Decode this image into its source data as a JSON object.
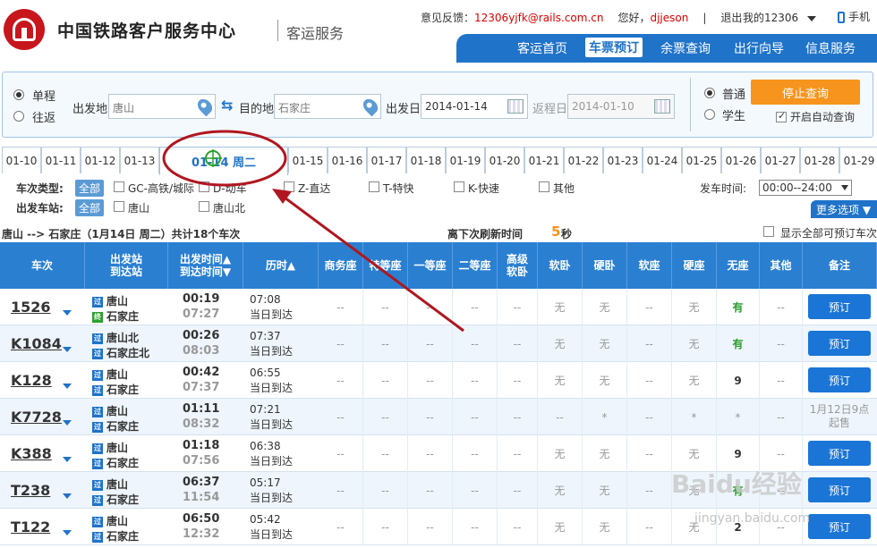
{
  "header": {
    "site_title": "中国铁路客户服务中心",
    "site_sub": "客运服务",
    "feedback_label": "意见反馈：",
    "feedback_email": "12306yjfk@rails.com.cn",
    "greeting": "您好，",
    "username": "djjeson",
    "logout": "退出",
    "my_account": "我的12306",
    "mobile": "手机"
  },
  "nav": [
    "客运首页",
    "车票预订",
    "余票查询",
    "出行向导",
    "信息服务"
  ],
  "search": {
    "trip_single": "单程",
    "trip_round": "往返",
    "from_label": "出发地",
    "from_value": "唐山",
    "to_label": "目的地",
    "to_value": "石家庄",
    "date_label": "出发日",
    "date_value": "2014-01-14",
    "return_label": "返程日",
    "return_value": "2014-01-10",
    "ticket_normal": "普通",
    "ticket_student": "学生",
    "stop_button": "停止查询",
    "auto_query": "开启自动查询"
  },
  "date_tabs": [
    "01-10",
    "01-11",
    "01-12",
    "01-13",
    "01-14 周二",
    "01-15",
    "01-16",
    "01-17",
    "01-18",
    "01-19",
    "01-20",
    "01-21",
    "01-22",
    "01-23",
    "01-24",
    "01-25",
    "01-26",
    "01-27",
    "01-28",
    "01-29"
  ],
  "filters": {
    "type_label": "车次类型:",
    "all": "全部",
    "types": [
      "GC-高铁/城际",
      "D-动车",
      "Z-直达",
      "T-特快",
      "K-快速",
      "其他"
    ],
    "station_label": "出发车站:",
    "stations": [
      "唐山",
      "唐山北"
    ],
    "time_label": "发车时间:",
    "time_value": "00:00--24:00",
    "more": "更多选项"
  },
  "summary": {
    "route": "唐山 --> 石家庄（1月14日 周二）共计18个车次",
    "refresh_label": "离下次刷新时间",
    "refresh_value": "5",
    "refresh_unit": "秒",
    "show_all": "显示全部可预订车次"
  },
  "columns": [
    {
      "l1": "车次",
      "l2": ""
    },
    {
      "l1": "出发站",
      "l2": "到达站"
    },
    {
      "l1": "出发时间▲",
      "l2": "到达时间▼"
    },
    {
      "l1": "历时▲",
      "l2": ""
    },
    {
      "l1": "商务座",
      "l2": ""
    },
    {
      "l1": "特等座",
      "l2": ""
    },
    {
      "l1": "一等座",
      "l2": ""
    },
    {
      "l1": "二等座",
      "l2": ""
    },
    {
      "l1": "高级",
      "l2": "软卧"
    },
    {
      "l1": "软卧",
      "l2": ""
    },
    {
      "l1": "硬卧",
      "l2": ""
    },
    {
      "l1": "软座",
      "l2": ""
    },
    {
      "l1": "硬座",
      "l2": ""
    },
    {
      "l1": "无座",
      "l2": ""
    },
    {
      "l1": "其他",
      "l2": ""
    },
    {
      "l1": "备注",
      "l2": ""
    }
  ],
  "trains": [
    {
      "no": "1526",
      "from_tag": "过",
      "from": "唐山",
      "to_tag": "终",
      "to": "石家庄",
      "dep": "00:19",
      "arr": "07:27",
      "dur": "07:08",
      "arrive_day": "当日到达",
      "seats": [
        "--",
        "--",
        "--",
        "--",
        "--",
        "无",
        "无",
        "--",
        "无",
        "有",
        "--"
      ],
      "action": "预订"
    },
    {
      "no": "K1084",
      "from_tag": "过",
      "from": "唐山北",
      "to_tag": "过",
      "to": "石家庄北",
      "dep": "00:26",
      "arr": "08:03",
      "dur": "07:37",
      "arrive_day": "当日到达",
      "seats": [
        "--",
        "--",
        "--",
        "--",
        "--",
        "无",
        "无",
        "--",
        "无",
        "有",
        "--"
      ],
      "action": "预订"
    },
    {
      "no": "K128",
      "from_tag": "过",
      "from": "唐山",
      "to_tag": "过",
      "to": "石家庄",
      "dep": "00:42",
      "arr": "07:37",
      "dur": "06:55",
      "arrive_day": "当日到达",
      "seats": [
        "--",
        "--",
        "--",
        "--",
        "--",
        "无",
        "无",
        "--",
        "无",
        "9",
        "--"
      ],
      "action": "预订"
    },
    {
      "no": "K7728",
      "from_tag": "过",
      "from": "唐山",
      "to_tag": "过",
      "to": "石家庄",
      "dep": "01:11",
      "arr": "08:32",
      "dur": "07:21",
      "arrive_day": "当日到达",
      "seats": [
        "--",
        "--",
        "--",
        "--",
        "--",
        "--",
        "*",
        "--",
        "*",
        "*",
        "--"
      ],
      "note": "1月12日9点起售"
    },
    {
      "no": "K388",
      "from_tag": "过",
      "from": "唐山",
      "to_tag": "过",
      "to": "石家庄",
      "dep": "01:18",
      "arr": "07:56",
      "dur": "06:38",
      "arrive_day": "当日到达",
      "seats": [
        "--",
        "--",
        "--",
        "--",
        "--",
        "无",
        "无",
        "--",
        "无",
        "9",
        "--"
      ],
      "action": "预订"
    },
    {
      "no": "T238",
      "from_tag": "过",
      "from": "唐山",
      "to_tag": "过",
      "to": "石家庄",
      "dep": "06:37",
      "arr": "11:54",
      "dur": "05:17",
      "arrive_day": "当日到达",
      "seats": [
        "--",
        "--",
        "--",
        "--",
        "--",
        "无",
        "无",
        "--",
        "无",
        "有",
        "--"
      ],
      "action": "预订"
    },
    {
      "no": "T122",
      "from_tag": "过",
      "from": "唐山",
      "to_tag": "过",
      "to": "石家庄",
      "dep": "06:50",
      "arr": "12:32",
      "dur": "05:42",
      "arrive_day": "当日到达",
      "seats": [
        "--",
        "--",
        "--",
        "--",
        "--",
        "无",
        "无",
        "--",
        "无",
        "2",
        "--"
      ],
      "action": "预订"
    }
  ],
  "watermark": {
    "text": "Baidu经验",
    "url": "jingyan.baidu.com"
  },
  "colors": {
    "brand_blue": "#1f73c9",
    "header_blue": "#2a7fd1",
    "accent_orange": "#f7941d",
    "annotation_red": "#b0171f",
    "logo_red": "#c8161d"
  }
}
